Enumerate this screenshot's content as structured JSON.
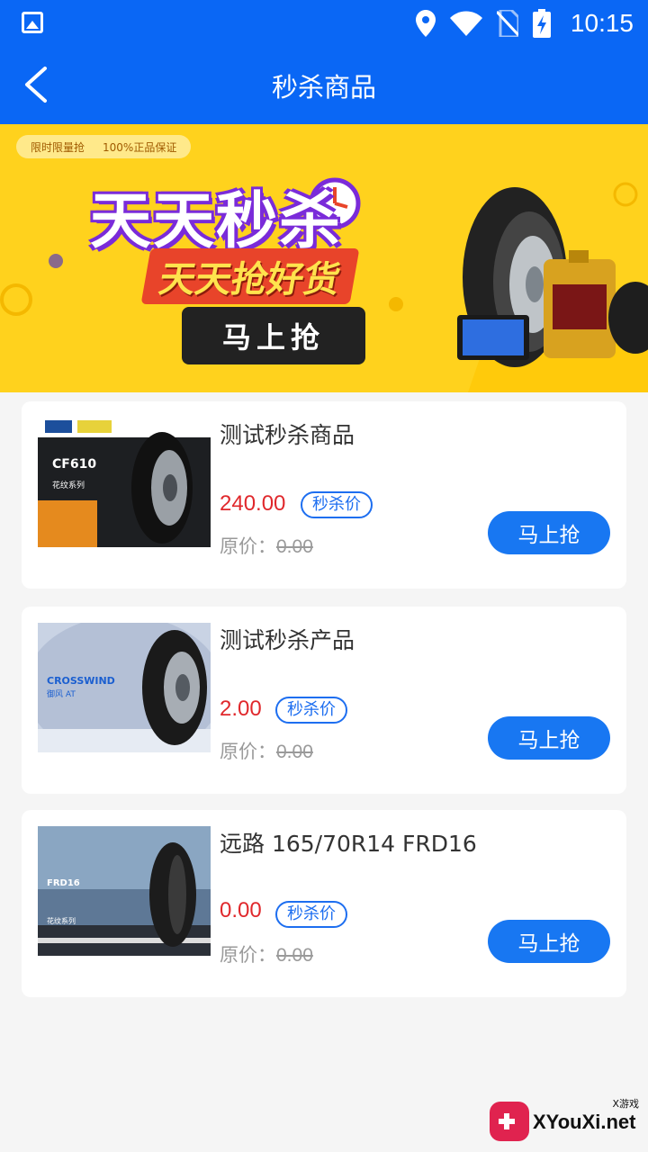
{
  "status_bar": {
    "time": "10:15",
    "icons": [
      "image-icon",
      "location-icon",
      "wifi-icon",
      "no-sim-icon",
      "battery-charging-icon"
    ]
  },
  "header": {
    "title": "秒杀商品",
    "back_icon": "chevron-left-icon"
  },
  "banner": {
    "tag1": "限时限量抢",
    "tag2": "100%正品保证",
    "headline": "天天秒杀",
    "subline": "天天抢好货",
    "button": "马上抢"
  },
  "products": [
    {
      "name": "测试秒杀商品",
      "price": "240.00",
      "badge": "秒杀价",
      "orig_label": "原价：",
      "orig_price": "0.00",
      "button": "马上抢",
      "thumb_text": "CF610",
      "thumb_sub": "花纹系列"
    },
    {
      "name": "测试秒杀产品",
      "price": "2.00",
      "badge": "秒杀价",
      "orig_label": "原价：",
      "orig_price": "0.00",
      "button": "马上抢",
      "thumb_text": "CROSSWIND",
      "thumb_sub": "御风 AT"
    },
    {
      "name": "远路 165/70R14 FRD16",
      "price": "0.00",
      "badge": "秒杀价",
      "orig_label": "原价：",
      "orig_price": "0.00",
      "button": "马上抢",
      "thumb_text": "FRD16",
      "thumb_sub": "花纹系列"
    }
  ],
  "watermark": {
    "small": "X游戏",
    "text": "XYouXi.net"
  },
  "colors": {
    "primary": "#0a67f5",
    "price": "#e0282c",
    "button": "#1877f2",
    "banner_bg": "#ffd21d"
  }
}
